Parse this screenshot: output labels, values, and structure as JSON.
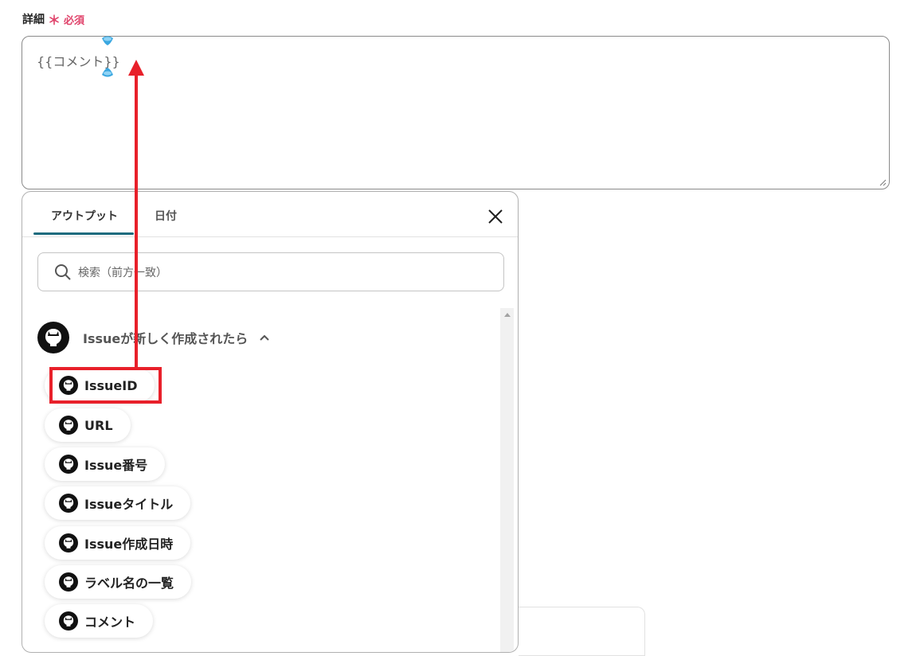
{
  "field": {
    "label": "詳細",
    "required_star": "＊",
    "required_text": "必須",
    "value": "{{コメント}}"
  },
  "panel": {
    "tabs": [
      {
        "label": "アウトプット",
        "active": true
      },
      {
        "label": "日付",
        "active": false
      }
    ],
    "search_placeholder": "検索（前方一致）",
    "group": {
      "title": "Issueが新しく作成されたら",
      "items": [
        {
          "label": "IssueID",
          "highlighted": true
        },
        {
          "label": "URL"
        },
        {
          "label": "Issue番号"
        },
        {
          "label": "Issueタイトル"
        },
        {
          "label": "Issue作成日時"
        },
        {
          "label": "ラベル名の一覧"
        },
        {
          "label": "コメント"
        }
      ]
    }
  },
  "colors": {
    "accent": "#1e6b7e",
    "required": "#e0436b",
    "annotation": "#e8202a",
    "caret": "#3aa7e0"
  }
}
